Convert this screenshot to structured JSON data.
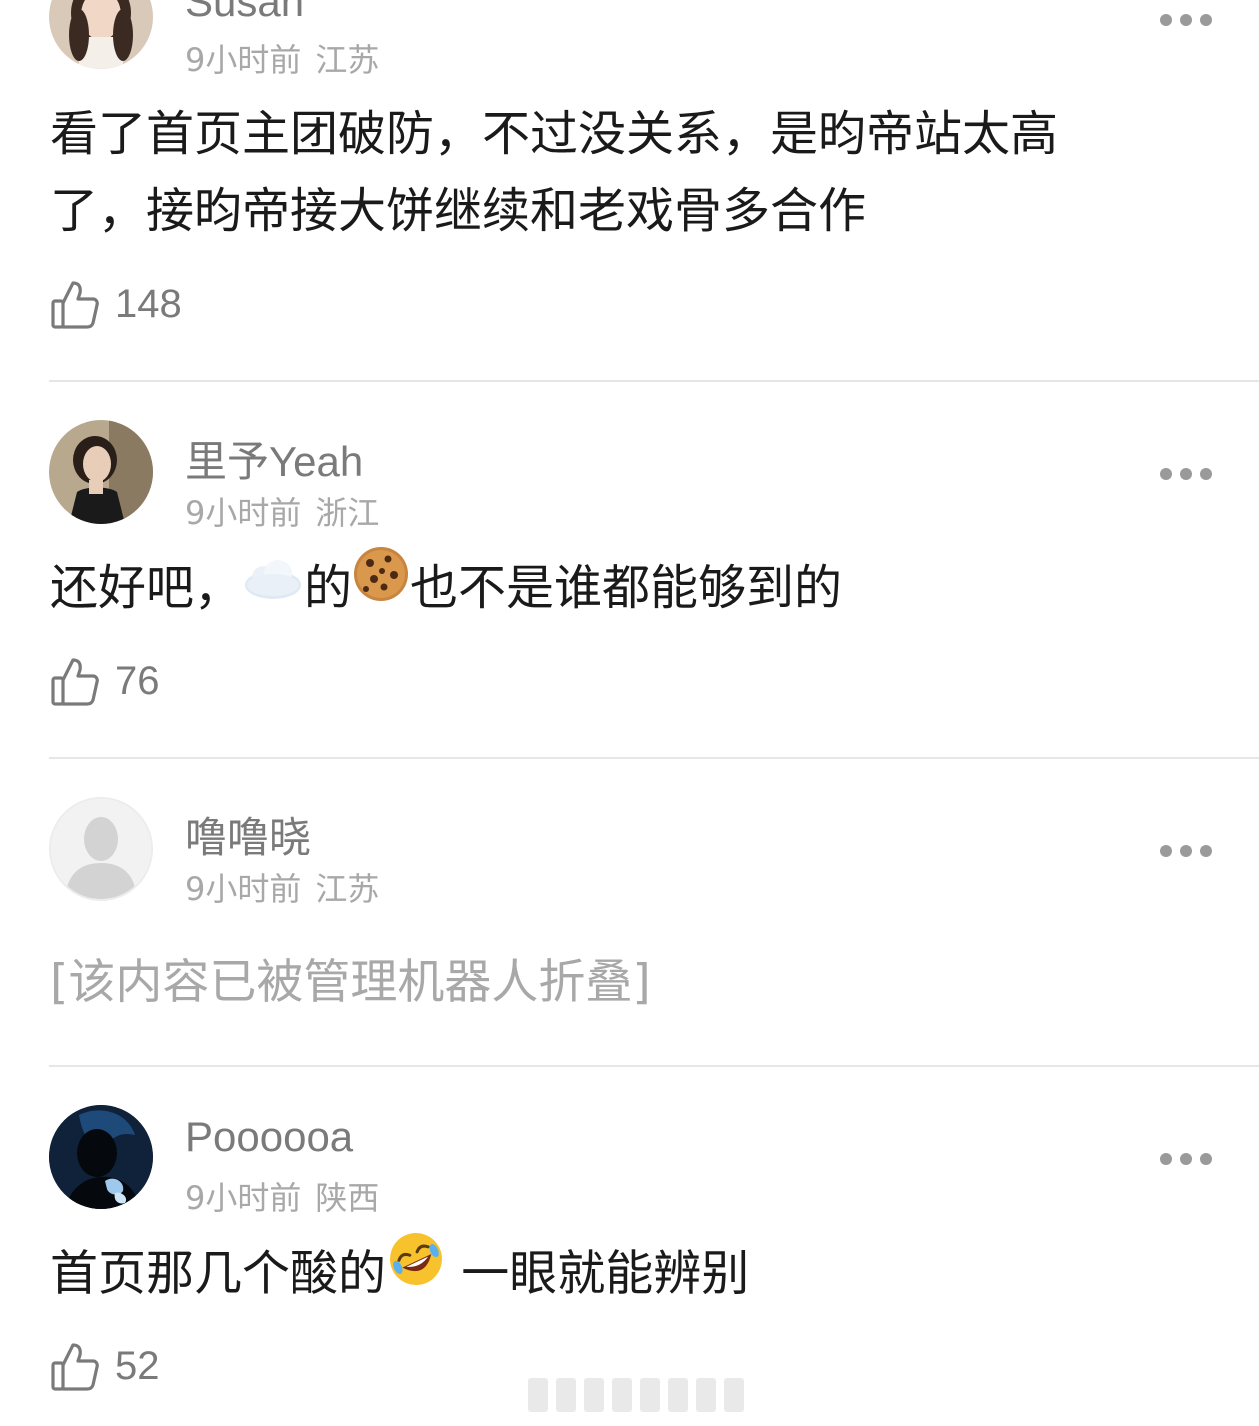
{
  "comments": [
    {
      "username": "Susan",
      "time": "9小时前",
      "location": "江苏",
      "text_line1": "看了首页主团破防，不过没关系，是昀帝站太高",
      "text_line2": "了，接昀帝接大饼继续和老戏骨多合作",
      "likes": "148"
    },
    {
      "username": "里予Yeah",
      "time": "9小时前",
      "location": "浙江",
      "text_part1": "还好吧，",
      "emoji1": "cloud-emoji",
      "text_part2": "的",
      "emoji2": "cookie-emoji",
      "text_part3": "也不是谁都能够到的",
      "likes": "76"
    },
    {
      "username": "噜噜晓",
      "time": "9小时前",
      "location": "江苏",
      "folded_text": "[该内容已被管理机器人折叠]"
    },
    {
      "username": "Poooooa",
      "time": "9小时前",
      "location": "陕西",
      "text_part1": "首页那几个酸的",
      "emoji1": "rolling-on-floor-laughing-emoji",
      "text_part2": " 一眼就能辨别",
      "likes": "52"
    }
  ],
  "icons": {
    "more": "more-dots-icon",
    "like": "thumbs-up-icon"
  },
  "colors": {
    "text": "#1a1a1a",
    "secondary": "#7a7a7a",
    "muted": "#a8a8a8",
    "divider": "#e6e6e6"
  }
}
